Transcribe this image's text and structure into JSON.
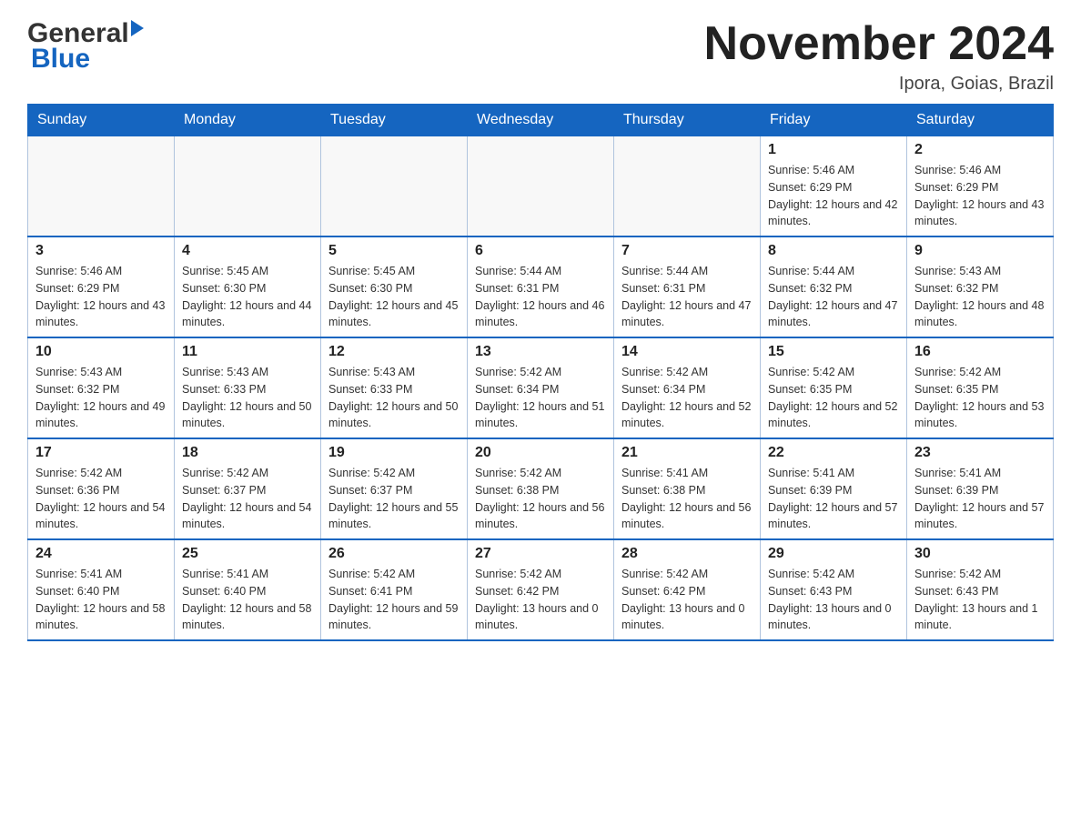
{
  "header": {
    "logo_general": "General",
    "logo_blue": "Blue",
    "title": "November 2024",
    "subtitle": "Ipora, Goias, Brazil"
  },
  "days_of_week": [
    "Sunday",
    "Monday",
    "Tuesday",
    "Wednesday",
    "Thursday",
    "Friday",
    "Saturday"
  ],
  "weeks": [
    [
      {
        "day": "",
        "sunrise": "",
        "sunset": "",
        "daylight": ""
      },
      {
        "day": "",
        "sunrise": "",
        "sunset": "",
        "daylight": ""
      },
      {
        "day": "",
        "sunrise": "",
        "sunset": "",
        "daylight": ""
      },
      {
        "day": "",
        "sunrise": "",
        "sunset": "",
        "daylight": ""
      },
      {
        "day": "",
        "sunrise": "",
        "sunset": "",
        "daylight": ""
      },
      {
        "day": "1",
        "sunrise": "Sunrise: 5:46 AM",
        "sunset": "Sunset: 6:29 PM",
        "daylight": "Daylight: 12 hours and 42 minutes."
      },
      {
        "day": "2",
        "sunrise": "Sunrise: 5:46 AM",
        "sunset": "Sunset: 6:29 PM",
        "daylight": "Daylight: 12 hours and 43 minutes."
      }
    ],
    [
      {
        "day": "3",
        "sunrise": "Sunrise: 5:46 AM",
        "sunset": "Sunset: 6:29 PM",
        "daylight": "Daylight: 12 hours and 43 minutes."
      },
      {
        "day": "4",
        "sunrise": "Sunrise: 5:45 AM",
        "sunset": "Sunset: 6:30 PM",
        "daylight": "Daylight: 12 hours and 44 minutes."
      },
      {
        "day": "5",
        "sunrise": "Sunrise: 5:45 AM",
        "sunset": "Sunset: 6:30 PM",
        "daylight": "Daylight: 12 hours and 45 minutes."
      },
      {
        "day": "6",
        "sunrise": "Sunrise: 5:44 AM",
        "sunset": "Sunset: 6:31 PM",
        "daylight": "Daylight: 12 hours and 46 minutes."
      },
      {
        "day": "7",
        "sunrise": "Sunrise: 5:44 AM",
        "sunset": "Sunset: 6:31 PM",
        "daylight": "Daylight: 12 hours and 47 minutes."
      },
      {
        "day": "8",
        "sunrise": "Sunrise: 5:44 AM",
        "sunset": "Sunset: 6:32 PM",
        "daylight": "Daylight: 12 hours and 47 minutes."
      },
      {
        "day": "9",
        "sunrise": "Sunrise: 5:43 AM",
        "sunset": "Sunset: 6:32 PM",
        "daylight": "Daylight: 12 hours and 48 minutes."
      }
    ],
    [
      {
        "day": "10",
        "sunrise": "Sunrise: 5:43 AM",
        "sunset": "Sunset: 6:32 PM",
        "daylight": "Daylight: 12 hours and 49 minutes."
      },
      {
        "day": "11",
        "sunrise": "Sunrise: 5:43 AM",
        "sunset": "Sunset: 6:33 PM",
        "daylight": "Daylight: 12 hours and 50 minutes."
      },
      {
        "day": "12",
        "sunrise": "Sunrise: 5:43 AM",
        "sunset": "Sunset: 6:33 PM",
        "daylight": "Daylight: 12 hours and 50 minutes."
      },
      {
        "day": "13",
        "sunrise": "Sunrise: 5:42 AM",
        "sunset": "Sunset: 6:34 PM",
        "daylight": "Daylight: 12 hours and 51 minutes."
      },
      {
        "day": "14",
        "sunrise": "Sunrise: 5:42 AM",
        "sunset": "Sunset: 6:34 PM",
        "daylight": "Daylight: 12 hours and 52 minutes."
      },
      {
        "day": "15",
        "sunrise": "Sunrise: 5:42 AM",
        "sunset": "Sunset: 6:35 PM",
        "daylight": "Daylight: 12 hours and 52 minutes."
      },
      {
        "day": "16",
        "sunrise": "Sunrise: 5:42 AM",
        "sunset": "Sunset: 6:35 PM",
        "daylight": "Daylight: 12 hours and 53 minutes."
      }
    ],
    [
      {
        "day": "17",
        "sunrise": "Sunrise: 5:42 AM",
        "sunset": "Sunset: 6:36 PM",
        "daylight": "Daylight: 12 hours and 54 minutes."
      },
      {
        "day": "18",
        "sunrise": "Sunrise: 5:42 AM",
        "sunset": "Sunset: 6:37 PM",
        "daylight": "Daylight: 12 hours and 54 minutes."
      },
      {
        "day": "19",
        "sunrise": "Sunrise: 5:42 AM",
        "sunset": "Sunset: 6:37 PM",
        "daylight": "Daylight: 12 hours and 55 minutes."
      },
      {
        "day": "20",
        "sunrise": "Sunrise: 5:42 AM",
        "sunset": "Sunset: 6:38 PM",
        "daylight": "Daylight: 12 hours and 56 minutes."
      },
      {
        "day": "21",
        "sunrise": "Sunrise: 5:41 AM",
        "sunset": "Sunset: 6:38 PM",
        "daylight": "Daylight: 12 hours and 56 minutes."
      },
      {
        "day": "22",
        "sunrise": "Sunrise: 5:41 AM",
        "sunset": "Sunset: 6:39 PM",
        "daylight": "Daylight: 12 hours and 57 minutes."
      },
      {
        "day": "23",
        "sunrise": "Sunrise: 5:41 AM",
        "sunset": "Sunset: 6:39 PM",
        "daylight": "Daylight: 12 hours and 57 minutes."
      }
    ],
    [
      {
        "day": "24",
        "sunrise": "Sunrise: 5:41 AM",
        "sunset": "Sunset: 6:40 PM",
        "daylight": "Daylight: 12 hours and 58 minutes."
      },
      {
        "day": "25",
        "sunrise": "Sunrise: 5:41 AM",
        "sunset": "Sunset: 6:40 PM",
        "daylight": "Daylight: 12 hours and 58 minutes."
      },
      {
        "day": "26",
        "sunrise": "Sunrise: 5:42 AM",
        "sunset": "Sunset: 6:41 PM",
        "daylight": "Daylight: 12 hours and 59 minutes."
      },
      {
        "day": "27",
        "sunrise": "Sunrise: 5:42 AM",
        "sunset": "Sunset: 6:42 PM",
        "daylight": "Daylight: 13 hours and 0 minutes."
      },
      {
        "day": "28",
        "sunrise": "Sunrise: 5:42 AM",
        "sunset": "Sunset: 6:42 PM",
        "daylight": "Daylight: 13 hours and 0 minutes."
      },
      {
        "day": "29",
        "sunrise": "Sunrise: 5:42 AM",
        "sunset": "Sunset: 6:43 PM",
        "daylight": "Daylight: 13 hours and 0 minutes."
      },
      {
        "day": "30",
        "sunrise": "Sunrise: 5:42 AM",
        "sunset": "Sunset: 6:43 PM",
        "daylight": "Daylight: 13 hours and 1 minute."
      }
    ]
  ]
}
